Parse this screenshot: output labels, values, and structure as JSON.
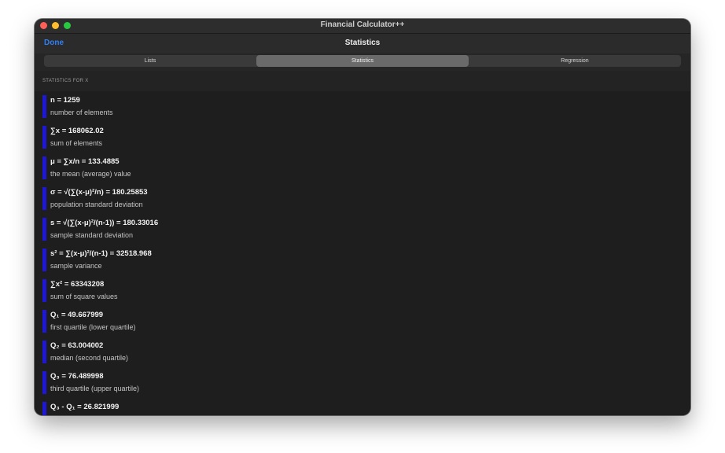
{
  "window": {
    "title": "Financial Calculator++"
  },
  "navbar": {
    "done_label": "Done",
    "title": "Statistics"
  },
  "tabs": [
    {
      "label": "Lists",
      "selected": false
    },
    {
      "label": "Statistics",
      "selected": true
    },
    {
      "label": "Regression",
      "selected": false
    }
  ],
  "section": {
    "header": "STATISTICS FOR X"
  },
  "stats": [
    {
      "value": "n = 1259",
      "description": "number of elements"
    },
    {
      "value": "∑x = 168062.02",
      "description": "sum of elements"
    },
    {
      "value": "μ = ∑x/n = 133.4885",
      "description": "the mean (average) value"
    },
    {
      "value": "σ = √(∑(x-μ)²/n) =  180.25853",
      "description": "population standard deviation"
    },
    {
      "value": "s = √(∑(x-μ)²/(n-1)) = 180.33016",
      "description": "sample standard deviation"
    },
    {
      "value": "s² = ∑(x-μ)²/(n-1) = 32518.968",
      "description": "sample variance"
    },
    {
      "value": "∑x² = 63343208",
      "description": "sum of square values"
    },
    {
      "value": "Q₁ = 49.667999",
      "description": "first quartile (lower quartile)"
    },
    {
      "value": "Q₂ = 63.004002",
      "description": "median (second quartile)"
    },
    {
      "value": "Q₃ = 76.489998",
      "description": "third quartile (upper quartile)"
    },
    {
      "value": "Q₃ - Q₁ = 26.821999",
      "description": ""
    }
  ],
  "colors": {
    "accent": "#2f7ff5",
    "stat_bar": "#1e18d6"
  }
}
